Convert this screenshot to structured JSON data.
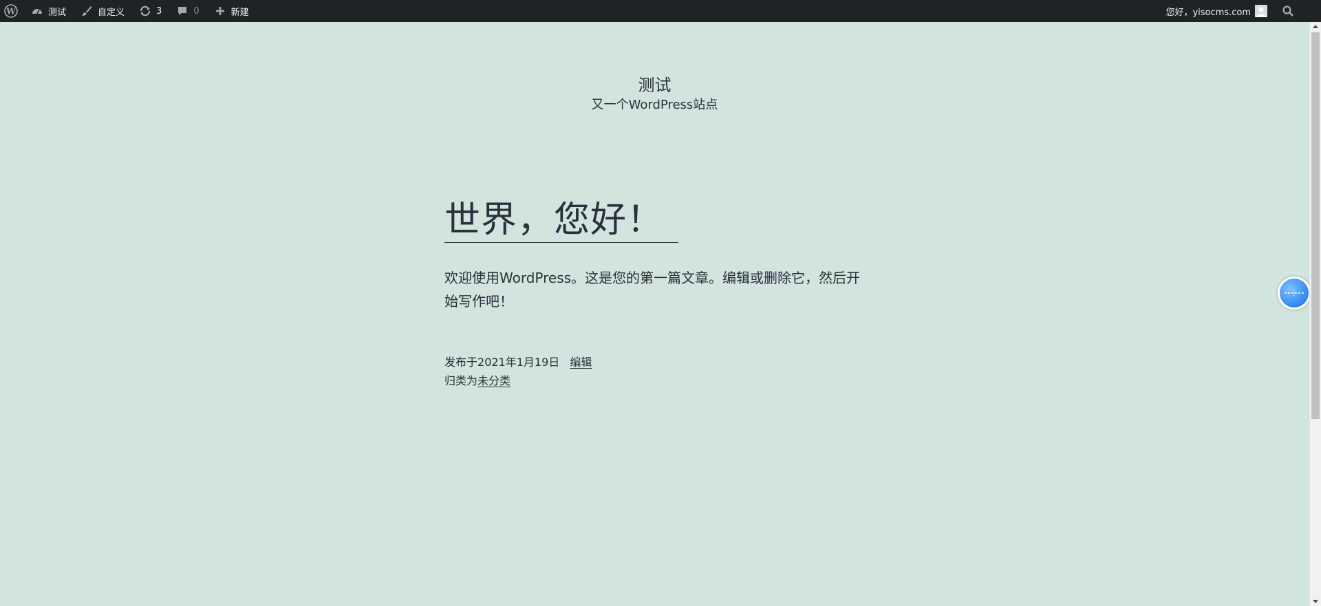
{
  "admin_bar": {
    "wp_logo_icon": "wordpress-logo-icon",
    "site_name": "测试",
    "customize": "自定义",
    "updates_count": "3",
    "comments_count": "0",
    "new": "新建",
    "greeting": "您好，yisocms.com",
    "colors": {
      "background": "#1d2327",
      "text": "#f0f0f1",
      "muted": "#8c8f94"
    }
  },
  "site": {
    "title": "测试",
    "description": "又一个WordPress站点",
    "background": "#d1e4dd",
    "text_color": "#28303d"
  },
  "post": {
    "title": "世界，您好！",
    "content": "欢迎使用WordPress。这是您的第一篇文章。编辑或删除它，然后开始写作吧！",
    "published_label": "发布于",
    "published_date": "2021年1月19日",
    "edit_label": "编辑",
    "category_label": "归类为",
    "category": "未分类"
  },
  "float_widget": {
    "icon": "floating-assistant-icon",
    "color": "#2f86f6"
  }
}
